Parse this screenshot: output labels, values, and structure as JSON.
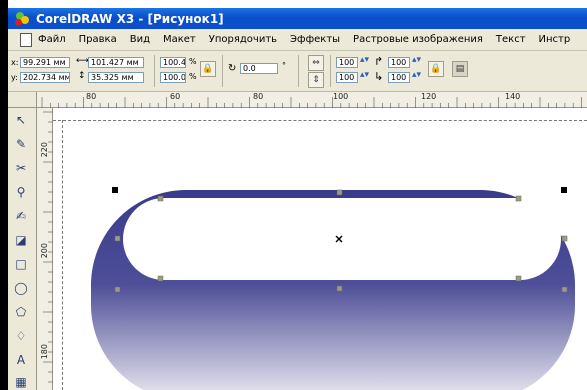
{
  "window": {
    "title": "CorelDRAW X3 - [Рисунок1]"
  },
  "menu": [
    "Файл",
    "Правка",
    "Вид",
    "Макет",
    "Упорядочить",
    "Эффекты",
    "Растровые изображения",
    "Текст",
    "Инстр"
  ],
  "property_bar": {
    "x_label": "x:",
    "x_value": "99.291 мм",
    "y_label": "y:",
    "y_value": "202.734 мм",
    "width_value": "101.427 мм",
    "height_value": "35.325 мм",
    "scale_x": "100.4",
    "scale_y": "100.0",
    "percent": "%",
    "rotation": "0.0",
    "corner_tl": "100",
    "corner_bl": "100",
    "corner_tr": "100",
    "corner_br": "100"
  },
  "ruler": {
    "top_labels": [
      "80",
      "60",
      "80",
      "100",
      "120",
      "140"
    ],
    "left_labels": [
      "220",
      "200",
      "180"
    ]
  },
  "tools": [
    "pick-tool-icon",
    "shape-tool-icon",
    "crop-tool-icon",
    "zoom-tool-icon",
    "freehand-tool-icon",
    "smart-fill-icon",
    "rectangle-tool-icon",
    "ellipse-tool-icon",
    "polygon-tool-icon",
    "basic-shapes-icon",
    "text-tool-icon"
  ],
  "colors": {
    "title_bar": "#0a4fc9",
    "shape_fill_top": "#3a3a8c",
    "shape_fill_bottom": "#eceaf2"
  }
}
